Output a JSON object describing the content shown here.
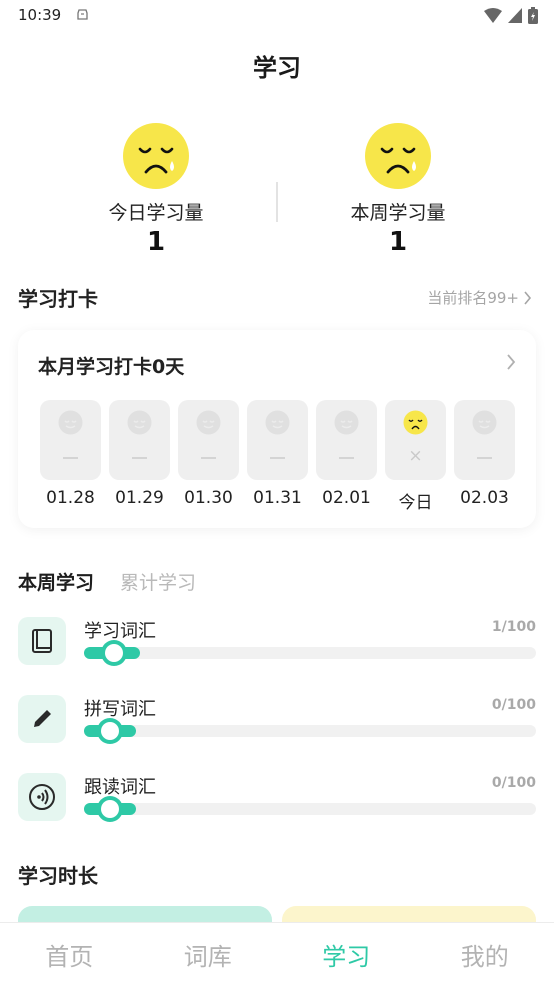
{
  "status": {
    "time": "10:39"
  },
  "header": {
    "title": "学习"
  },
  "summary": {
    "today": {
      "label": "今日学习量",
      "value": "1"
    },
    "week": {
      "label": "本周学习量",
      "value": "1"
    }
  },
  "checkin": {
    "section_title": "学习打卡",
    "rank_text": "当前排名99+",
    "card_title": "本月学习打卡0天",
    "days": [
      {
        "label": "01.28",
        "state": "empty"
      },
      {
        "label": "01.29",
        "state": "empty"
      },
      {
        "label": "01.30",
        "state": "empty"
      },
      {
        "label": "01.31",
        "state": "empty"
      },
      {
        "label": "02.01",
        "state": "empty"
      },
      {
        "label": "今日",
        "state": "missed",
        "mark": "×"
      },
      {
        "label": "02.03",
        "state": "empty"
      }
    ]
  },
  "tabs": {
    "active": "本周学习",
    "inactive": "累计学习"
  },
  "progress": [
    {
      "label": "学习词汇",
      "count": "1/100",
      "fraction": 0.01,
      "icon": "book-icon"
    },
    {
      "label": "拼写词汇",
      "count": "0/100",
      "fraction": 0.0,
      "icon": "pencil-icon"
    },
    {
      "label": "跟读词汇",
      "count": "0/100",
      "fraction": 0.0,
      "icon": "audio-icon"
    }
  ],
  "duration": {
    "title": "学习时长"
  },
  "nav": [
    "首页",
    "词库",
    "学习",
    "我的"
  ],
  "colors": {
    "accent": "#2ec9a6",
    "face": "#f7e64a"
  }
}
